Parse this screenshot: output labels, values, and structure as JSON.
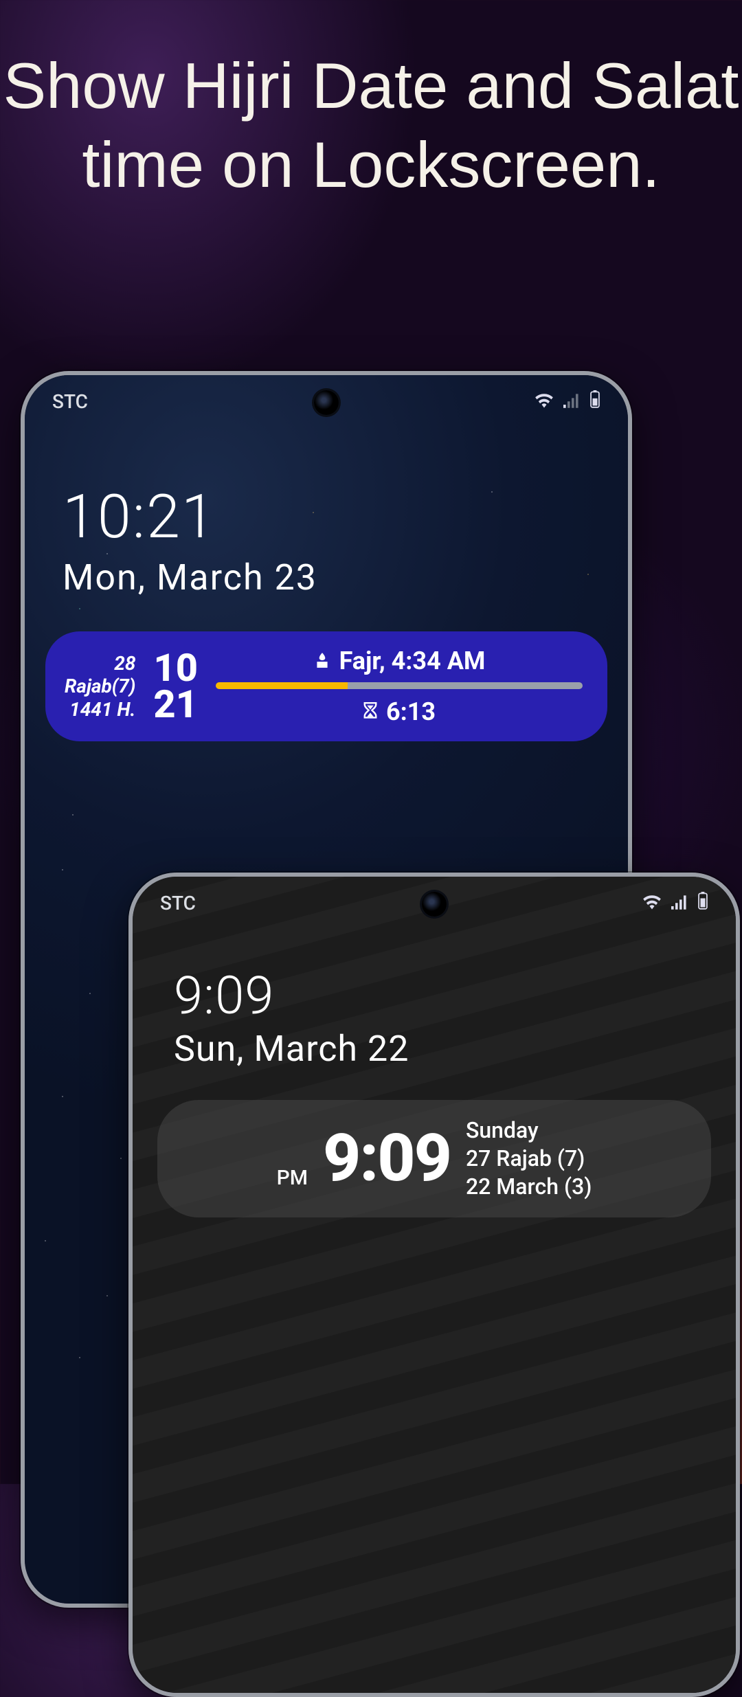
{
  "headline": "Show Hijri Date and Salat time on Lockscreen.",
  "phone_a": {
    "carrier": "STC",
    "time": "10:21",
    "date": "Mon, March 23",
    "widget": {
      "hijri_day": "28",
      "hijri_month": "Rajab(7)",
      "hijri_year": "1441 H.",
      "big_hour": "10",
      "big_min": "21",
      "next_prayer": "Fajr, 4:34 AM",
      "remaining": "6:13",
      "progress_pct": 36
    }
  },
  "phone_b": {
    "carrier": "STC",
    "time": "9:09",
    "date": "Sun, March 22",
    "widget": {
      "ampm": "PM",
      "time": "9:09",
      "weekday": "Sunday",
      "hijri": "27 Rajab (7)",
      "greg": "22 March (3)"
    }
  }
}
